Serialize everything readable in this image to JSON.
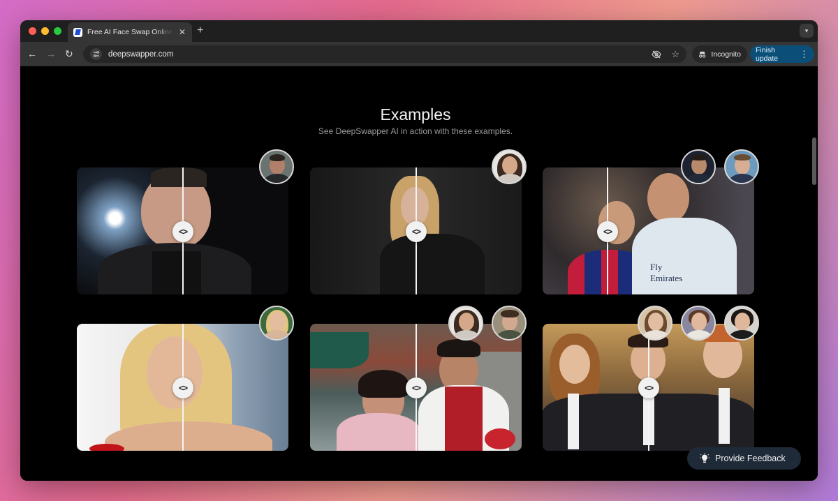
{
  "browser": {
    "tab_title": "Free AI Face Swap Online: Ins",
    "url": "deepswapper.com",
    "incognito_label": "Incognito",
    "finish_update_label": "Finish update"
  },
  "section": {
    "title": "Examples",
    "subtitle": "See DeepSwapper AI in action with these examples."
  },
  "examples": [
    {
      "thumbs": 1
    },
    {
      "thumbs": 1
    },
    {
      "thumbs": 2
    },
    {
      "thumbs": 1
    },
    {
      "thumbs": 2
    },
    {
      "thumbs": 3
    }
  ],
  "handle_glyph": "<>",
  "feedback_label": "Provide Feedback",
  "colors": {
    "finish_update_bg": "#0b4f78",
    "feedback_bg": "#1f2a38",
    "page_bg": "#000000"
  }
}
